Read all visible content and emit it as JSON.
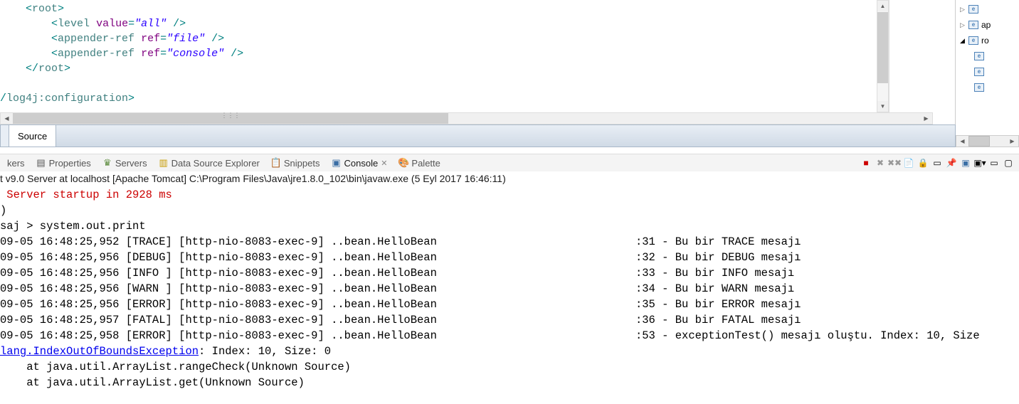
{
  "editor": {
    "line1_tag": "root",
    "line2_tag": "level",
    "line2_attr": "value",
    "line2_val": "\"all\"",
    "line3_tag": "appender-ref",
    "line3_attr": "ref",
    "line3_val": "\"file\"",
    "line4_tag": "appender-ref",
    "line4_attr": "ref",
    "line4_val": "\"console\"",
    "line5_tag": "root",
    "line6_tag": "log4j:configuration"
  },
  "source_tab": "Source",
  "outline": {
    "items": [
      "",
      "ap",
      "ro",
      "",
      "",
      ""
    ]
  },
  "views": {
    "markers": "kers",
    "properties": "Properties",
    "servers": "Servers",
    "dse": "Data Source Explorer",
    "snippets": "Snippets",
    "console": "Console",
    "palette": "Palette"
  },
  "console_status": "t v9.0 Server at localhost [Apache Tomcat] C:\\Program Files\\Java\\jre1.8.0_102\\bin\\javaw.exe (5 Eyl 2017 16:46:11)",
  "console": {
    "startup": " Server startup in 2928 ms",
    "paren": ")",
    "saj": "saj > system.out.print",
    "lines": [
      "09-05 16:48:25,952 [TRACE] [http-nio-8083-exec-9] ..bean.HelloBean                              :31 - Bu bir TRACE mesajı",
      "09-05 16:48:25,956 [DEBUG] [http-nio-8083-exec-9] ..bean.HelloBean                              :32 - Bu bir DEBUG mesajı",
      "09-05 16:48:25,956 [INFO ] [http-nio-8083-exec-9] ..bean.HelloBean                              :33 - Bu bir INFO mesajı",
      "09-05 16:48:25,956 [WARN ] [http-nio-8083-exec-9] ..bean.HelloBean                              :34 - Bu bir WARN mesajı",
      "09-05 16:48:25,956 [ERROR] [http-nio-8083-exec-9] ..bean.HelloBean                              :35 - Bu bir ERROR mesajı",
      "09-05 16:48:25,957 [FATAL] [http-nio-8083-exec-9] ..bean.HelloBean                              :36 - Bu bir FATAL mesajı",
      "09-05 16:48:25,958 [ERROR] [http-nio-8083-exec-9] ..bean.HelloBean                              :53 - exceptionTest() mesajı oluştu. Index: 10, Size"
    ],
    "exception": "lang.IndexOutOfBoundsException",
    "exception_tail": ": Index: 10, Size: 0",
    "stack1": "    at java.util.ArrayList.rangeCheck(Unknown Source)",
    "stack2": "    at java.util.ArrayList.get(Unknown Source)"
  }
}
